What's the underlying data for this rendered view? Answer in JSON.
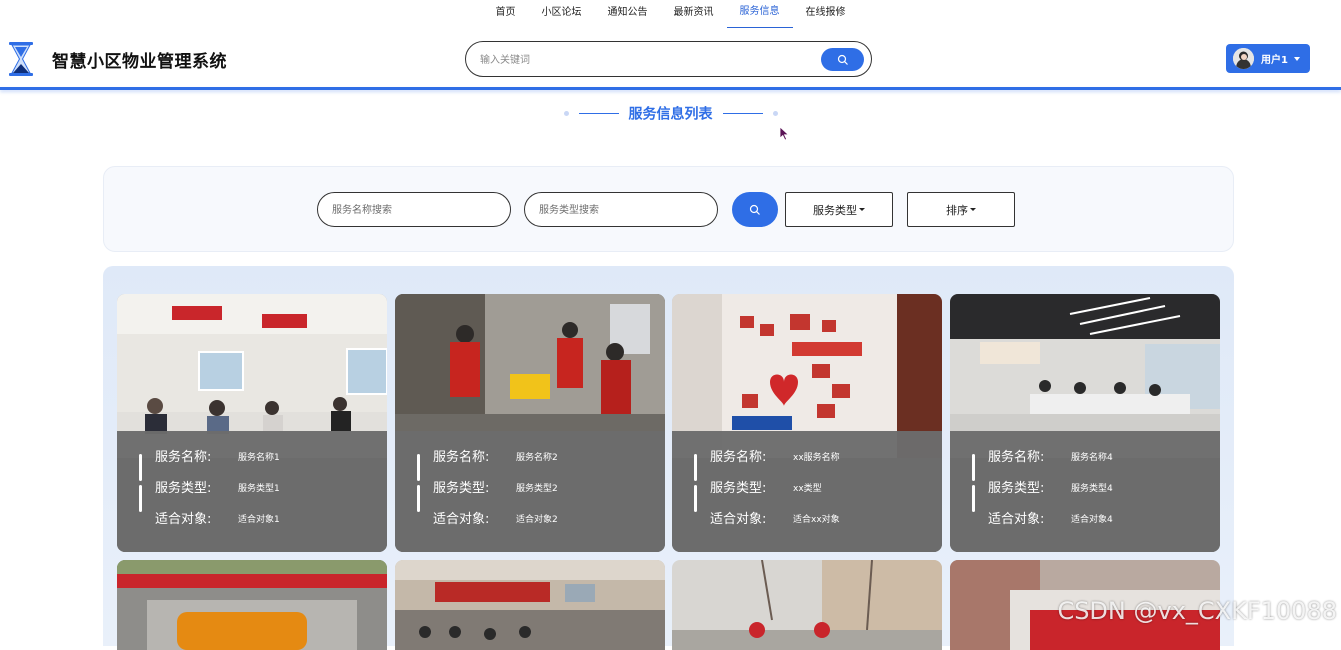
{
  "nav": {
    "items": [
      {
        "label": "首页"
      },
      {
        "label": "小区论坛"
      },
      {
        "label": "通知公告"
      },
      {
        "label": "最新资讯"
      },
      {
        "label": "服务信息"
      },
      {
        "label": "在线报修"
      }
    ],
    "active_index": 4
  },
  "header": {
    "title": "智慧小区物业管理系统",
    "search_placeholder": "输入关键词",
    "user_label": "用户1"
  },
  "section": {
    "title": "服务信息列表"
  },
  "filters": {
    "name_placeholder": "服务名称搜索",
    "type_placeholder": "服务类型搜索",
    "type_dropdown": "服务类型",
    "sort_dropdown": "排序"
  },
  "cards": [
    {
      "name_label": "服务名称:",
      "name": "服务名称1",
      "type_label": "服务类型:",
      "type": "服务类型1",
      "target_label": "适合对象:",
      "target": "适合对象1"
    },
    {
      "name_label": "服务名称:",
      "name": "服务名称2",
      "type_label": "服务类型:",
      "type": "服务类型2",
      "target_label": "适合对象:",
      "target": "适合对象2"
    },
    {
      "name_label": "服务名称:",
      "name": "xx服务名称",
      "type_label": "服务类型:",
      "type": "xx类型",
      "target_label": "适合对象:",
      "target": "适合xx对象"
    },
    {
      "name_label": "服务名称:",
      "name": "服务名称4",
      "type_label": "服务类型:",
      "type": "服务类型4",
      "target_label": "适合对象:",
      "target": "适合对象4"
    }
  ],
  "watermark": "CSDN @vx_CXKF10088",
  "colors": {
    "accent": "#2f6ee6",
    "card_overlay": "#6c6c6c",
    "grid_background": "#e3ecf8"
  }
}
